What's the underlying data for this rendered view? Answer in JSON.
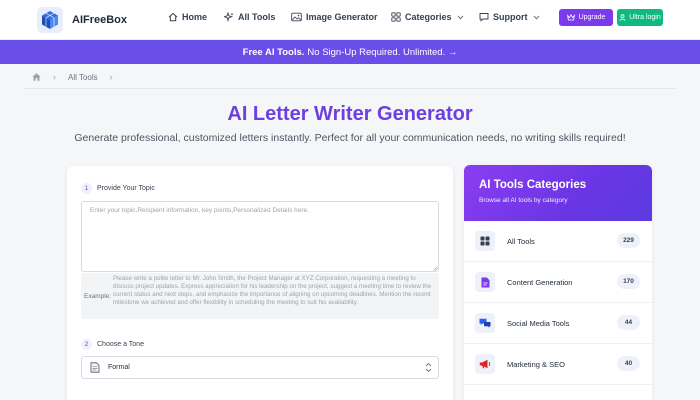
{
  "header": {
    "brand": "AIFreeBox",
    "nav": [
      {
        "label": "Home",
        "icon": "home-icon"
      },
      {
        "label": "All Tools",
        "icon": "sparkle-icon"
      },
      {
        "label": "Image Generator",
        "icon": "image-icon"
      },
      {
        "label": "Categories",
        "icon": "grid-icon"
      },
      {
        "label": "Support",
        "icon": "chat-icon"
      }
    ],
    "upgrade_label": "Upgrade",
    "login_label": "Ultra login"
  },
  "banner": {
    "bold": "Free AI Tools.",
    "text": "No Sign-Up Required. Unlimited. →"
  },
  "breadcrumb": {
    "items": [
      "All Tools"
    ]
  },
  "hero": {
    "title": "AI Letter Writer Generator",
    "subtitle": "Generate professional, customized letters instantly. Perfect for all your communication needs, no writing skills required!"
  },
  "form": {
    "step1_num": "1",
    "step1_label": "Provide Your Topic",
    "topic_placeholder": "Enter your topic,Recipient information, key points,Personalized Details here.",
    "topic_value": "",
    "example_label": "Example:",
    "example_text": "Please write a polite letter to Mr. John Smith, the Project Manager at XYZ Corporation, requesting a meeting to discuss project updates. Express appreciation for his leadership on the project, suggest a meeting time to review the current status and next steps, and emphasize the importance of aligning on upcoming deadlines. Mention the recent milestone we achieved and offer flexibility in scheduling the meeting to suit his availability.",
    "step2_num": "2",
    "step2_label": "Choose a Tone",
    "tone_value": "Formal"
  },
  "categories": {
    "title": "AI Tools Categories",
    "subtitle": "Browse all AI tools by category",
    "items": [
      {
        "label": "All Tools",
        "count": "229",
        "icon": "grid-icon",
        "color": "#374151"
      },
      {
        "label": "Content Generation",
        "count": "170",
        "icon": "document-icon",
        "color": "#7c3aed"
      },
      {
        "label": "Social Media Tools",
        "count": "44",
        "icon": "chat-bubbles-icon",
        "color": "#2563eb"
      },
      {
        "label": "Marketing & SEO",
        "count": "40",
        "icon": "megaphone-icon",
        "color": "#dc2626"
      }
    ]
  },
  "colors": {
    "accent": "#6d3fe0",
    "banner": "#6a4ee8",
    "upgrade": "#7c3aed",
    "login": "#10b981"
  }
}
